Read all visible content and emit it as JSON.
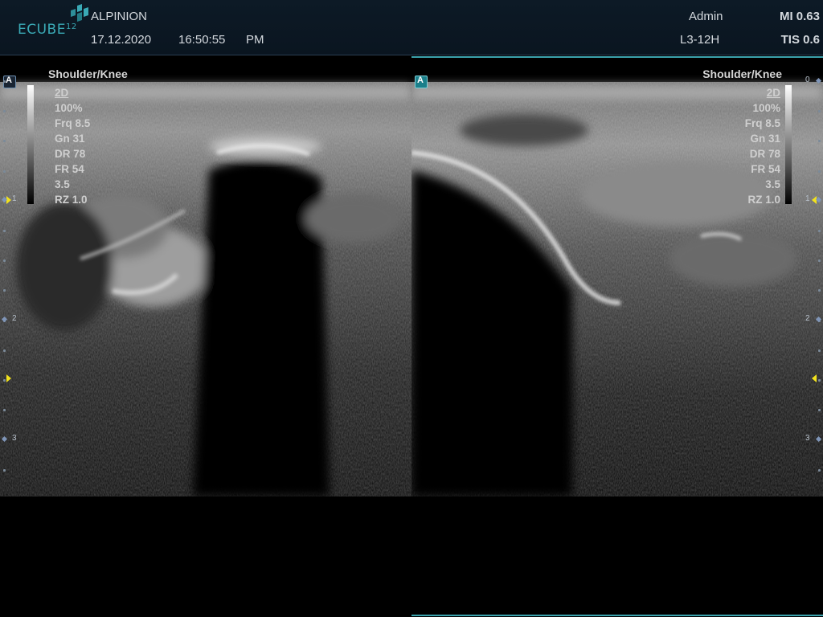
{
  "header": {
    "brand": "ALPINION",
    "logo_text": "ECUBE",
    "logo_model": "12",
    "date": "17.12.2020",
    "time": "16:50:55",
    "ampm": "PM",
    "user": "Admin",
    "probe": "L3-12H",
    "mi": "MI 0.63",
    "tis": "TIS 0.6"
  },
  "panels": {
    "left": {
      "badge": "A",
      "preset": "Shoulder/Knee",
      "params": [
        "2D",
        "100%",
        "Frq 8.5",
        "Gn 31",
        "DR 78",
        "FR 54",
        "3.5",
        "RZ 1.0"
      ]
    },
    "right": {
      "badge": "A",
      "preset": "Shoulder/Knee",
      "params": [
        "2D",
        "100%",
        "Frq 8.5",
        "Gn 31",
        "DR 78",
        "FR 54",
        "3.5",
        "RZ 1.0"
      ]
    }
  },
  "depth_scale": {
    "labels": [
      "0",
      "1",
      "2",
      "3"
    ]
  },
  "colors": {
    "accent": "#3ba3ad",
    "focus_marker": "#f2e21d",
    "header_bg": "#0d1a26"
  }
}
